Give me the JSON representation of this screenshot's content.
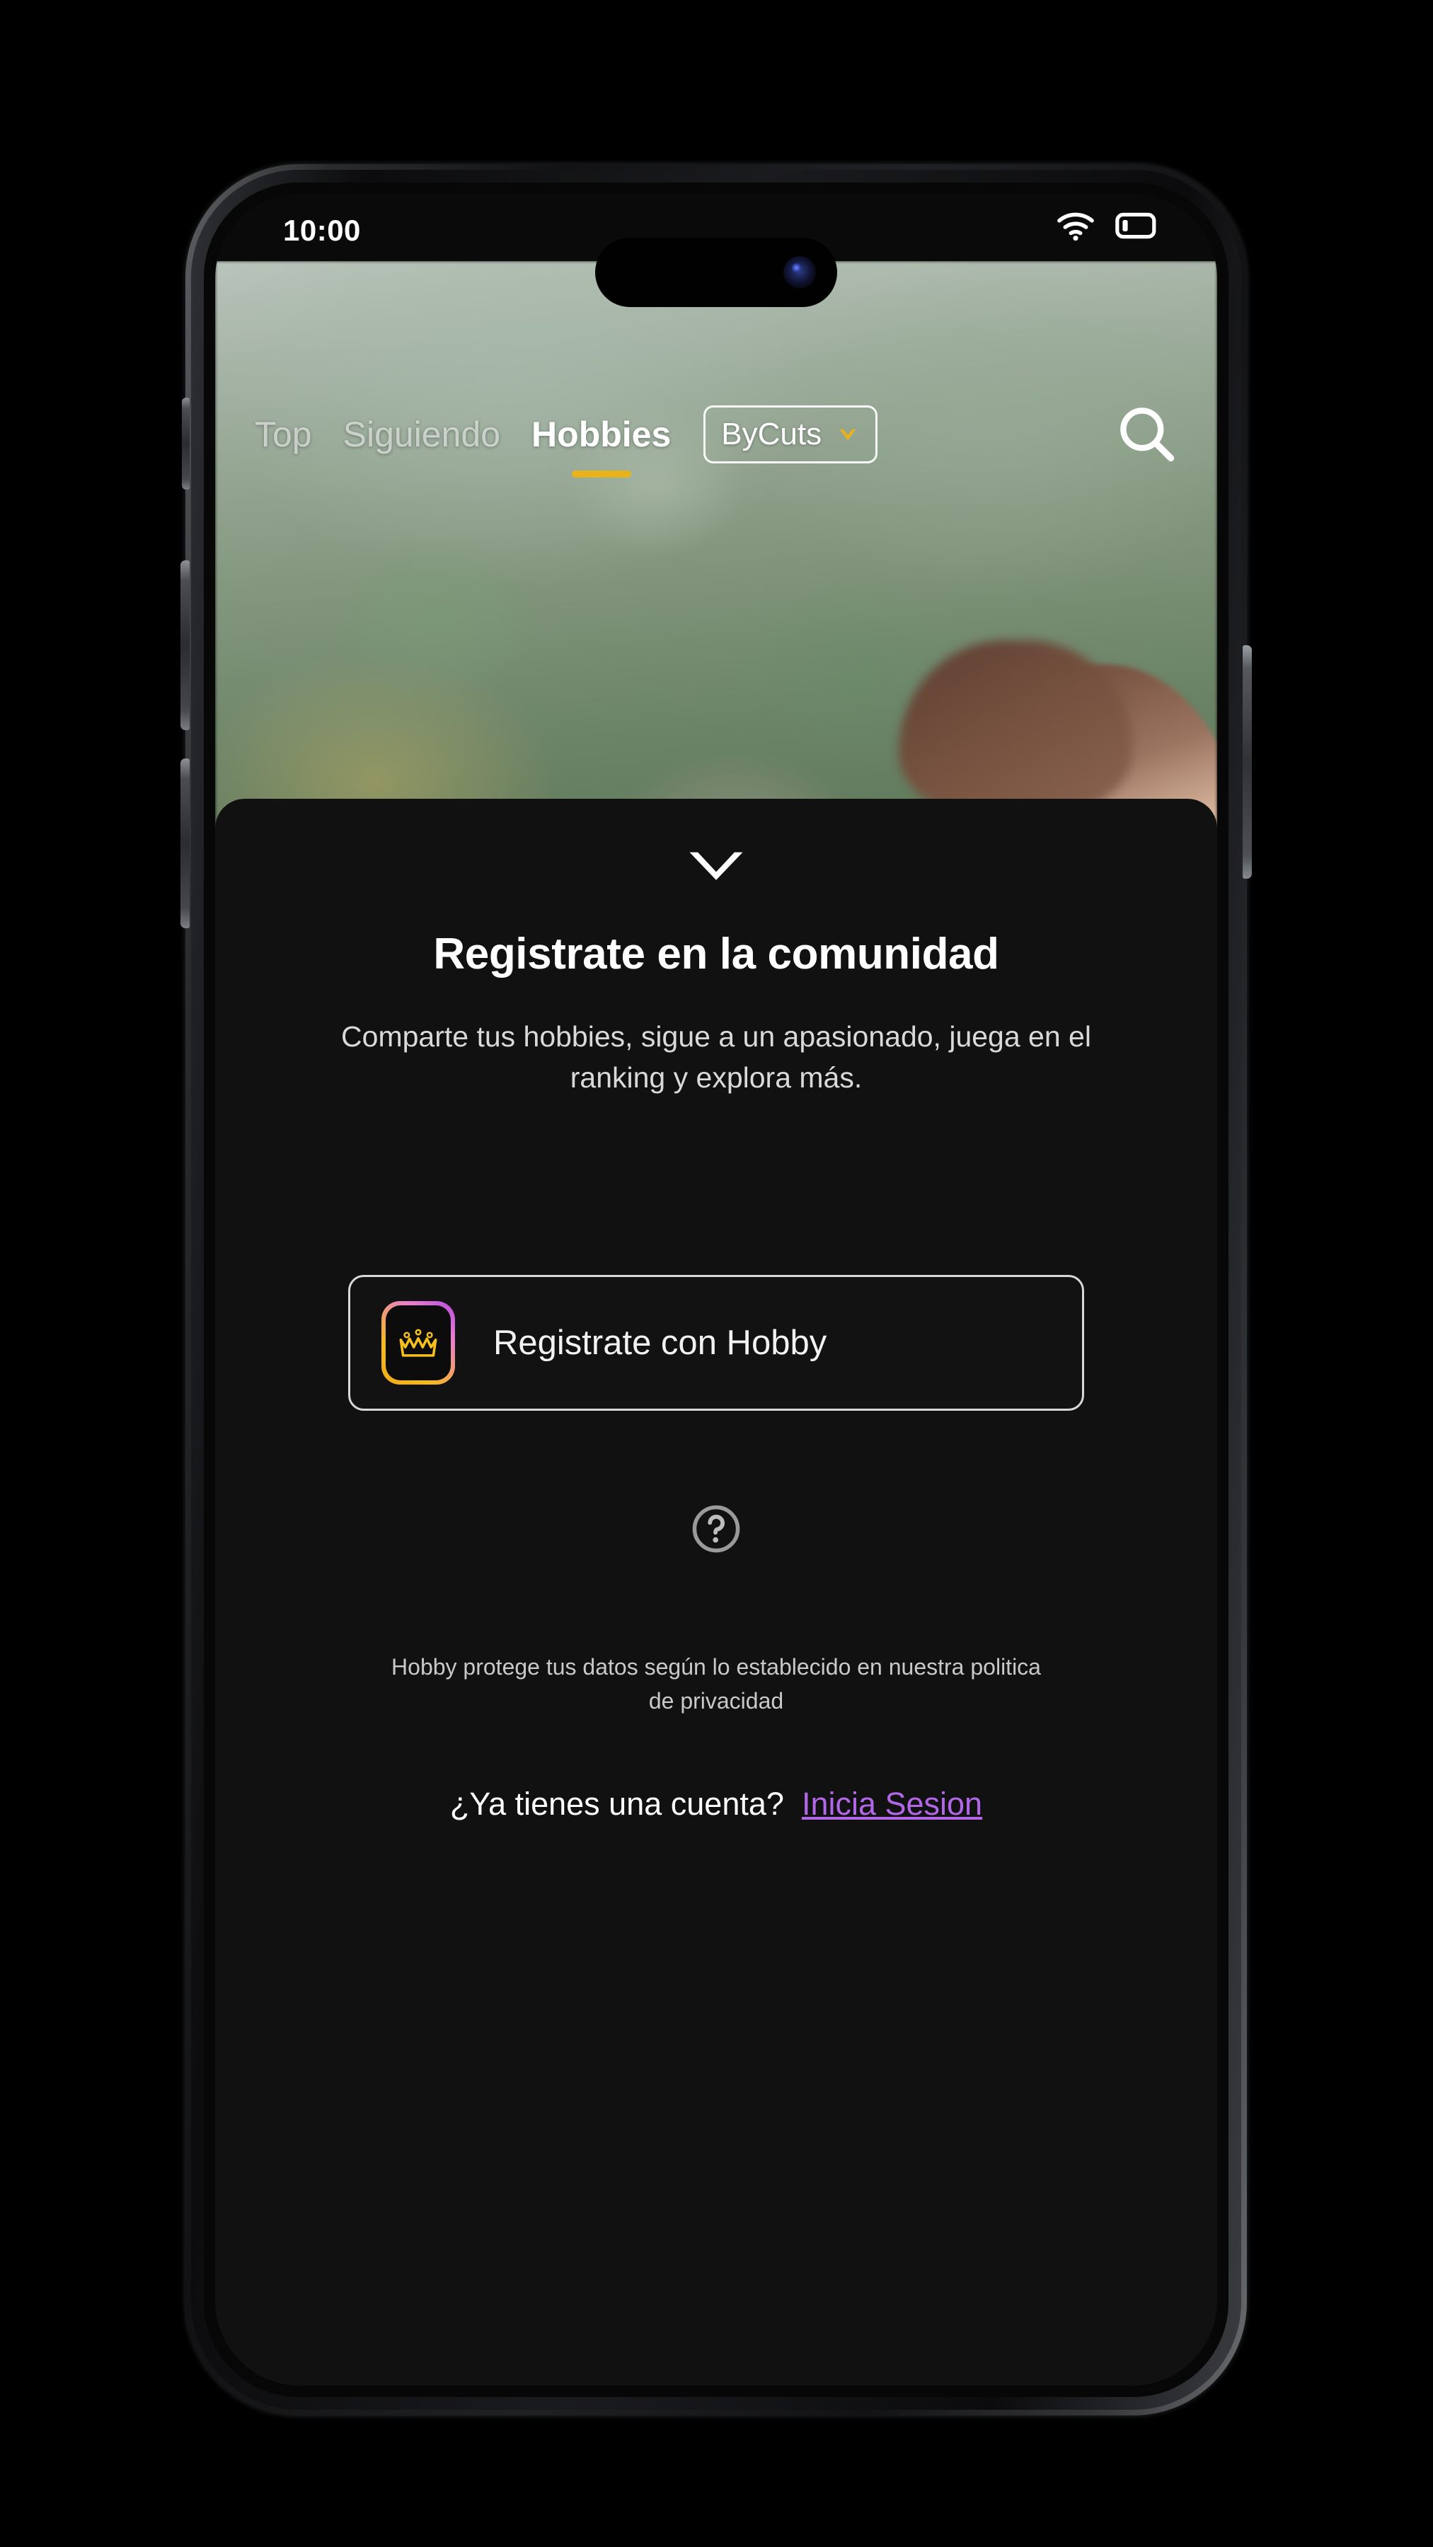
{
  "status_bar": {
    "time": "10:00",
    "wifi_icon": "wifi-icon",
    "battery_icon": "battery-low-icon"
  },
  "top_nav": {
    "tabs": [
      {
        "label": "Top",
        "active": false
      },
      {
        "label": "Siguiendo",
        "active": false
      },
      {
        "label": "Hobbies",
        "active": true
      }
    ],
    "filter": {
      "label": "ByCuts",
      "chevron_icon": "chevron-down-icon",
      "chevron_color": "#e8b21c"
    },
    "search_icon": "search-icon",
    "active_underline_color": "#e8b21c"
  },
  "sheet": {
    "collapse_icon": "chevron-down-icon",
    "title": "Registrate en la comunidad",
    "subtitle": "Comparte tus hobbies, sigue a un apasionado, juega en el ranking y explora más.",
    "signup_button": {
      "label": "Registrate con Hobby",
      "logo_icon": "crown-logo-icon",
      "logo_gradient_from": "#f0a81a",
      "logo_gradient_to": "#b64ae0"
    },
    "help_icon": "question-circle-icon",
    "privacy_note": "Hobby protege tus datos según lo establecido en nuestra politica de privacidad",
    "account_prompt": "¿Ya tienes una cuenta?",
    "account_link": "Inicia Sesion",
    "account_link_color": "#b267e8",
    "background_color": "#111111"
  }
}
